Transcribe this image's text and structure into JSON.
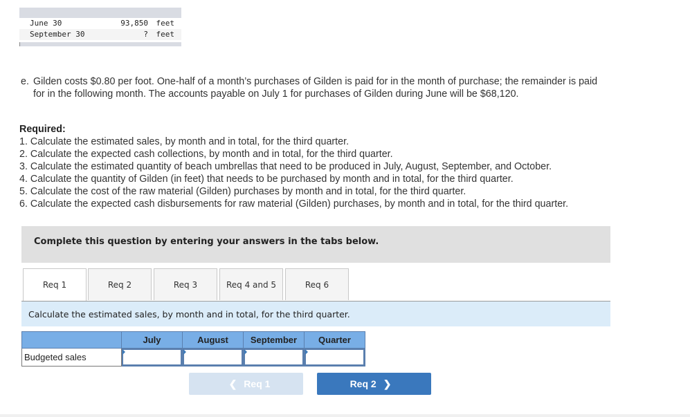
{
  "top_table": {
    "rows": [
      {
        "label": "June 30",
        "value": "93,850",
        "unit": "feet"
      },
      {
        "label": "September 30",
        "value": "?",
        "unit": "feet"
      }
    ]
  },
  "paragraph_e": {
    "letter": "e.",
    "line1": "Gilden costs $0.80 per foot. One-half of a month’s purchases of Gilden is paid for in the month of purchase; the remainder is paid",
    "line2": "for in the following month. The accounts payable on July 1 for purchases of Gilden during June will be $68,120."
  },
  "required": {
    "title": "Required:",
    "items": [
      "1. Calculate the estimated sales, by month and in total, for the third quarter.",
      "2. Calculate the expected cash collections, by month and in total, for the third quarter.",
      "3. Calculate the estimated quantity of beach umbrellas that need to be produced in July, August, September, and October.",
      "4. Calculate the quantity of Gilden (in feet) that needs to be purchased by month and in total, for the third quarter.",
      "5. Calculate the cost of the raw material (Gilden) purchases by month and in total, for the third quarter.",
      "6. Calculate the expected cash disbursements for raw material (Gilden) purchases, by month and in total, for the third quarter."
    ]
  },
  "banner": "Complete this question by entering your answers in the tabs below.",
  "tabs": [
    {
      "label": "Req 1",
      "active": true
    },
    {
      "label": "Req 2",
      "active": false
    },
    {
      "label": "Req 3",
      "active": false
    },
    {
      "label": "Req 4 and 5",
      "active": false
    },
    {
      "label": "Req 6",
      "active": false
    }
  ],
  "instruction": "Calculate the estimated sales, by month and in total, for the third quarter.",
  "answer_table": {
    "columns": [
      "July",
      "August",
      "September",
      "Quarter"
    ],
    "row_label": "Budgeted sales",
    "values": [
      "",
      "",
      "",
      ""
    ]
  },
  "nav": {
    "prev_label": "Req 1",
    "next_label": "Req 2",
    "prev_icon": "chevron-left-icon",
    "next_icon": "chevron-right-icon"
  },
  "colors": {
    "header_blue": "#78aee6",
    "next_button": "#3a78bd",
    "prev_button_disabled": "#d6e3f1",
    "instruction_bg": "#dbecf9"
  }
}
